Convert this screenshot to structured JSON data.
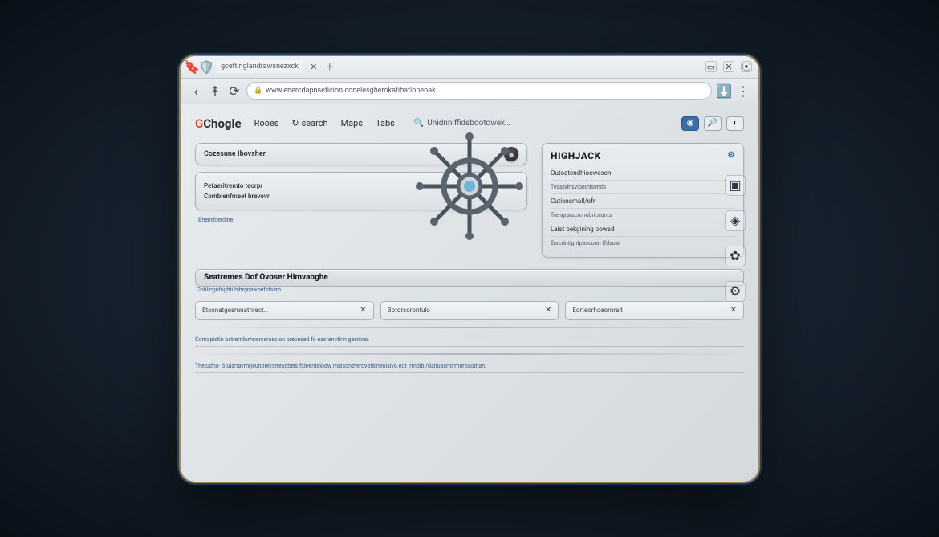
{
  "tab": {
    "title": "gcettinglandrawsnezxck"
  },
  "address": {
    "url": "www.enercdapnseticion.conelesgherokatibatloneoak"
  },
  "logo": {
    "prefix": "G",
    "rest": "Chogle"
  },
  "nav": {
    "items": [
      "Rooes",
      "search",
      "Maps",
      "Tabs"
    ],
    "search_placeholder": "Unidnniffidebootowek…"
  },
  "left_cards": {
    "card1": "Cozesune Ibovsher",
    "card2_line1": "Pefaeritremto teorpr",
    "card2_line2": "Combienfmeet brevovr",
    "small_link": "Bhentfcerdine"
  },
  "right_panel": {
    "title": "HIGHJACK",
    "items": [
      "Outoatendhioewesen",
      "Tesatylhsvionthisends",
      "Cutisnemall/ofr",
      "Trengrarscrnhobriceants",
      "Laist bekgining bowsd",
      "Eorcdntightpascoon ffdsow"
    ]
  },
  "section": {
    "title": "Seatremes dof ovoser himvaoghe"
  },
  "filters": {
    "header": "Onhlingefnghtilhihrgnawnetstsem",
    "box1_text": "Etosnatgesrunatnrect…",
    "box2_text": "Botorsorontulo",
    "box3_text": "Eorteorhoeornrait"
  },
  "footer": {
    "note1": "Comapistin bstrerrdorhnercerascion precesed fo easrenctinn gesmrar.",
    "note2": "Thetudho· Stularravrnrjeunoreysttesdbeis fideerdeiodw maisontherovafslneolsivo.eot ·rrndlbl/daituasmirmnrosotitan."
  }
}
